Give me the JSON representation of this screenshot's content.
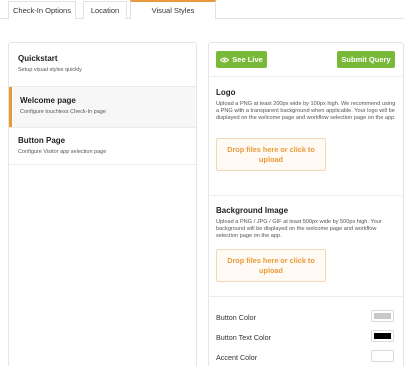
{
  "tabs": [
    {
      "label": "Check-In Options"
    },
    {
      "label": "Location"
    },
    {
      "label": "Visual Styles"
    }
  ],
  "menu": [
    {
      "title": "Quickstart",
      "subtitle": "Setup visual styles quickly"
    },
    {
      "title": "Welcome page",
      "subtitle": "Configure touchless Check-In page"
    },
    {
      "title": "Button Page",
      "subtitle": "Configure Visitor app selection page"
    }
  ],
  "actions": {
    "see_live": "See Live",
    "submit": "Submit Query"
  },
  "logo": {
    "title": "Logo",
    "description": "Upload a PNG at least 200px wide by 100px high. We recommend using a PNG with a transparent background when applicable. Your logo will be displayed on the welcome page and workflow selection page on the app.",
    "dropzone": "Drop files here or click to upload"
  },
  "background": {
    "title": "Background Image",
    "description": "Upload a PNG / JPG / GIF at least 500px wide by 500px high. Your background will be displayed on the welcome page and workflow selection page on the app.",
    "dropzone": "Drop files here or click to upload"
  },
  "colors": [
    {
      "label": "Button Color",
      "value": "#c8c8c8"
    },
    {
      "label": "Button Text Color",
      "value": "#000000"
    },
    {
      "label": "Accent Color",
      "value": "#ffffff"
    }
  ],
  "theme": {
    "accent": "#e99a3a",
    "primary_button": "#79b93a"
  }
}
